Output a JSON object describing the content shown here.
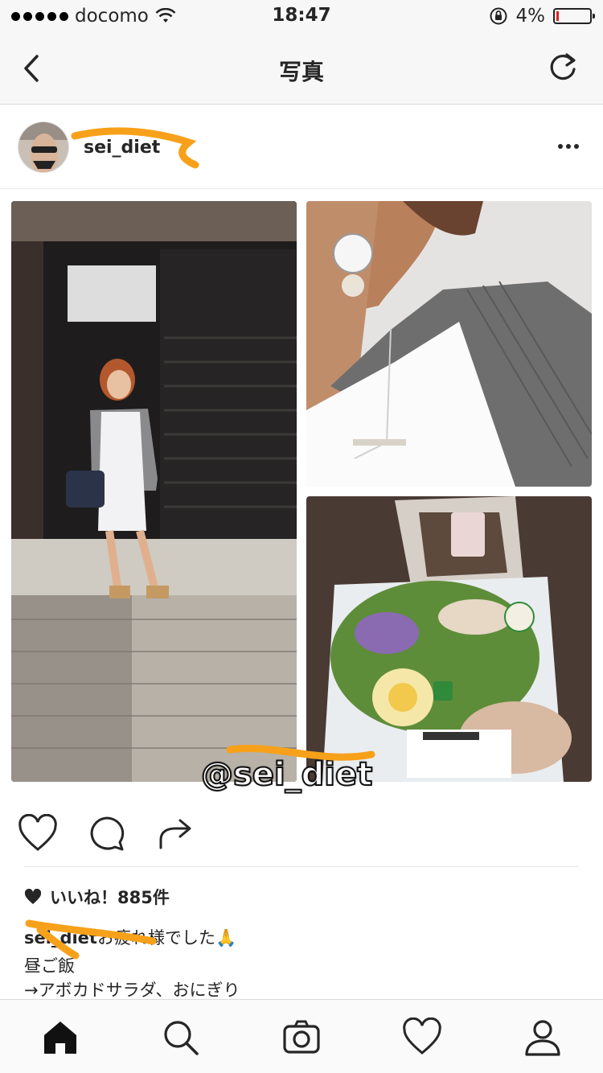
{
  "status_bar": {
    "carrier": "docomo",
    "time": "18:47",
    "battery_percent": "4%"
  },
  "nav": {
    "title": "写真",
    "back_icon": "chevron-left-icon",
    "refresh_icon": "refresh-icon"
  },
  "post": {
    "username": "sei_diet",
    "image_watermark": "@sei_diet",
    "likes_text": "いいね！885件",
    "caption": {
      "user": "sei_diet",
      "line1_text": "お疲れ様でした🙏",
      "line2": "昼ご飯",
      "line3": "→アボカドサラダ、おにぎり"
    }
  },
  "tabs": [
    {
      "name": "home",
      "icon": "home-icon"
    },
    {
      "name": "search",
      "icon": "search-icon"
    },
    {
      "name": "camera",
      "icon": "camera-icon"
    },
    {
      "name": "activity",
      "icon": "heart-icon"
    },
    {
      "name": "profile",
      "icon": "person-icon"
    }
  ],
  "colors": {
    "redaction": "#f7a11a",
    "text": "#262626",
    "bar_bg": "#f7f7f7"
  }
}
